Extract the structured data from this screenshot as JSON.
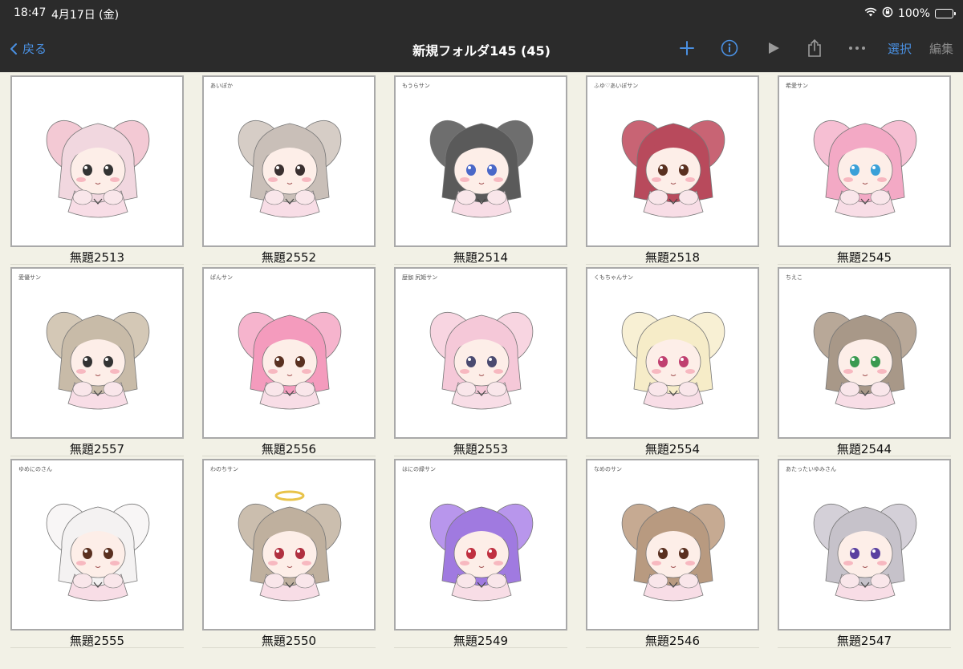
{
  "status": {
    "time": "18:47",
    "date": "4月17日 (金)",
    "battery": "100%"
  },
  "nav": {
    "back_label": "戻る",
    "title": "新規フォルダ145 (45)",
    "select_label": "選択",
    "edit_label": "編集"
  },
  "icons": {
    "add": "plus-icon",
    "info": "info-icon",
    "play": "play-icon",
    "share": "share-icon",
    "more": "more-icon"
  },
  "colors": {
    "accent": "#4a90e2",
    "bar": "#2b2b2b",
    "background": "#f2f1e6"
  },
  "artworks": [
    {
      "label": "無題2513",
      "note": "",
      "hair": "#f1d7df",
      "ear": "#f3c9d4",
      "eye": "#333333",
      "halo": false
    },
    {
      "label": "無題2552",
      "note": "あいぽか",
      "hair": "#c9bfb8",
      "ear": "#d6cdc6",
      "eye": "#3a3030",
      "halo": false
    },
    {
      "label": "無題2514",
      "note": "もうらサン",
      "hair": "#5a5a5a",
      "ear": "#6e6e6e",
      "eye": "#4a68c8",
      "halo": false
    },
    {
      "label": "無題2518",
      "note": "ふゆ♡あいぽサン",
      "hair": "#b84a5c",
      "ear": "#c86474",
      "eye": "#5a3020",
      "halo": false
    },
    {
      "label": "無題2545",
      "note": "希愛サン",
      "hair": "#f3a9c5",
      "ear": "#f6bfd3",
      "eye": "#3aa0d8",
      "halo": false
    },
    {
      "label": "無題2557",
      "note": "愛優サン",
      "hair": "#c8bba8",
      "ear": "#d4c8b6",
      "eye": "#333333",
      "halo": false
    },
    {
      "label": "無題2556",
      "note": "ぱんサン",
      "hair": "#f49bbd",
      "ear": "#f6b4cd",
      "eye": "#5a3020",
      "halo": false
    },
    {
      "label": "無題2553",
      "note": "歴伽 尻姫サン",
      "hair": "#f5c8d8",
      "ear": "#f8d5e1",
      "eye": "#4a4a70",
      "halo": false
    },
    {
      "label": "無題2554",
      "note": "くもちゃんサン",
      "hair": "#f6ecc8",
      "ear": "#f8f0d4",
      "eye": "#c04070",
      "halo": false
    },
    {
      "label": "無題2544",
      "note": "ちえこ",
      "hair": "#a89888",
      "ear": "#b8a898",
      "eye": "#3a9a50",
      "halo": false
    },
    {
      "label": "無題2555",
      "note": "ゆめにのさん",
      "hair": "#f4f2f2",
      "ear": "#f8f6f6",
      "eye": "#5a3020",
      "halo": false
    },
    {
      "label": "無題2550",
      "note": "わのちサン",
      "hair": "#bfb09e",
      "ear": "#cbbeae",
      "eye": "#b03040",
      "halo": true
    },
    {
      "label": "無題2549",
      "note": "はにの緑サン",
      "hair": "#a07ae0",
      "ear": "#b896ec",
      "eye": "#c03040",
      "halo": false
    },
    {
      "label": "無題2546",
      "note": "なめのサン",
      "hair": "#b89a80",
      "ear": "#c6aa92",
      "eye": "#5a3020",
      "halo": false
    },
    {
      "label": "無題2547",
      "note": "あたったいゆみさん",
      "hair": "#c6c2ca",
      "ear": "#d4d0d8",
      "eye": "#5a40a0",
      "halo": false
    }
  ]
}
